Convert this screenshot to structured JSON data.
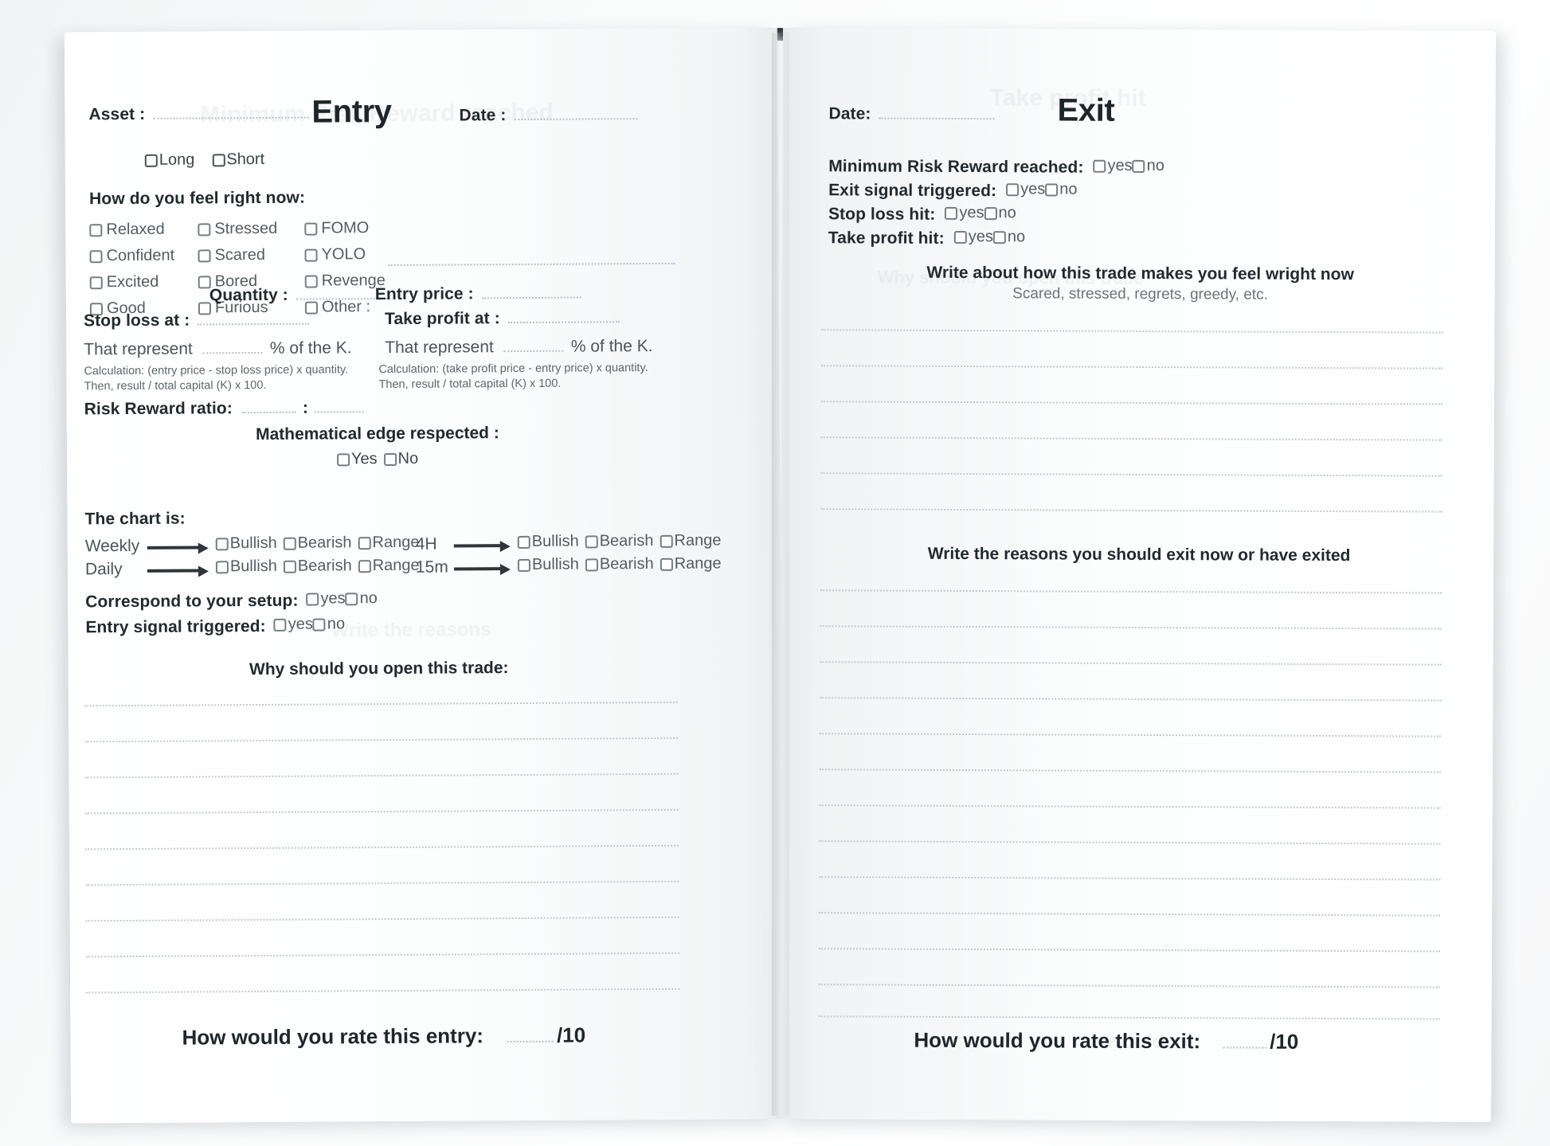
{
  "document": {
    "kind": "trading-journal-spread"
  },
  "left_page": {
    "title": "Entry",
    "asset_label": "Asset :",
    "date_label": "Date :",
    "direction_options": [
      "Long",
      "Short"
    ],
    "feelings_heading": "How do you feel right now:",
    "feelings_col1": [
      "Relaxed",
      "Confident",
      "Excited",
      "Good"
    ],
    "feelings_col2": [
      "Stressed",
      "Scared",
      "Bored",
      "Furious"
    ],
    "feelings_col3": [
      "FOMO",
      "YOLO",
      "Revenge",
      "Other :"
    ],
    "quantity_label": "Quantity :",
    "entry_price_label": "Entry price :",
    "stop_loss_label": "Stop loss at :",
    "take_profit_label": "Take profit at :",
    "represent_label": "That represent",
    "percent_suffix": "%  of the K.",
    "calc_stop_line1": "Calculation: (entry price - stop loss price) x quantity.",
    "calc_stop_line2": "Then, result / total capital (K) x 100.",
    "calc_take_line1": "Calculation: (take profit price - entry price) x quantity.",
    "calc_take_line2": "Then, result / total capital (K) x 100.",
    "risk_reward_label": "Risk Reward ratio:",
    "risk_reward_separator": ":",
    "math_edge_label": "Mathematical edge respected :",
    "math_edge_options": [
      "Yes",
      "No"
    ],
    "chart_is_label": "The chart is:",
    "timeframe_rows": [
      {
        "name": "Weekly",
        "options": [
          "Bullish",
          "Bearish",
          "Range"
        ]
      },
      {
        "name": "Daily",
        "options": [
          "Bullish",
          "Bearish",
          "Range"
        ]
      },
      {
        "name": "4H",
        "options": [
          "Bullish",
          "Bearish",
          "Range"
        ]
      },
      {
        "name": "15m",
        "options": [
          "Bullish",
          "Bearish",
          "Range"
        ]
      }
    ],
    "setup_label": "Correspond to your setup:",
    "entry_signal_label": "Entry signal triggered:",
    "yes_no": [
      "yes",
      "no"
    ],
    "why_open_heading": "Why should you open this trade:",
    "rating_label": "How would you rate this entry:",
    "rating_suffix": "/10"
  },
  "right_page": {
    "title": "Exit",
    "date_label": "Date:",
    "questions": [
      "Minimum Risk Reward reached:",
      "Exit signal triggered:",
      "Stop loss hit:",
      "Take profit hit:"
    ],
    "yes_no": [
      "yes",
      "no"
    ],
    "feel_heading": "Write about how this trade makes you feel wright now",
    "feel_subheading": "Scared, stressed, regrets, greedy, etc.",
    "reasons_heading": "Write the reasons you should exit now or have exited",
    "rating_label": "How would you rate this exit:",
    "rating_suffix": "/10"
  },
  "colors": {
    "ink": "#232a2e",
    "ink_light": "#5e6669",
    "rule": "#c3c9cd",
    "checkbox_border": "#767e83",
    "page": "#fcfdfd"
  }
}
